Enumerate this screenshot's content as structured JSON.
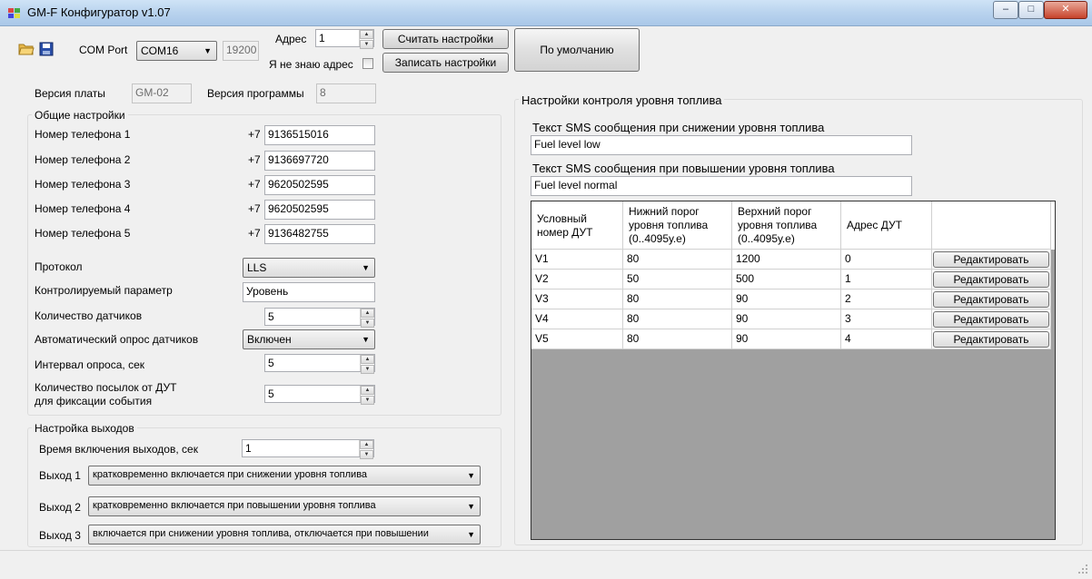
{
  "window": {
    "title": "GM-F Конфигуратор v1.07"
  },
  "toolbar": {
    "com_port_label": "COM Port",
    "com_port_value": "COM16",
    "baud_value": "19200",
    "address_label": "Адрес",
    "address_value": "1",
    "unknown_address_label": "Я не знаю адрес",
    "read_button": "Считать настройки",
    "write_button": "Записать настройки",
    "default_button": "По умолчанию"
  },
  "versions": {
    "board_label": "Версия платы",
    "board_value": "GM-02",
    "program_label": "Версия программы",
    "program_value": "8"
  },
  "general": {
    "title": "Общие настройки",
    "prefix": "+7",
    "phones": [
      {
        "label": "Номер телефона 1",
        "value": "9136515016"
      },
      {
        "label": "Номер телефона 2",
        "value": "9136697720"
      },
      {
        "label": "Номер телефона 3",
        "value": "9620502595"
      },
      {
        "label": "Номер телефона 4",
        "value": "9620502595"
      },
      {
        "label": "Номер телефона 5",
        "value": "9136482755"
      }
    ],
    "protocol_label": "Протокол",
    "protocol_value": "LLS",
    "param_label": "Контролируемый параметр",
    "param_value": "Уровень",
    "sensors_count_label": "Количество датчиков",
    "sensors_count_value": "5",
    "auto_poll_label": "Автоматический опрос датчиков",
    "auto_poll_value": "Включен",
    "interval_label": "Интервал опроса, сек",
    "interval_value": "5",
    "packets_label_1": "Количество посылок  от ДУТ",
    "packets_label_2": "для фиксации события",
    "packets_value": "5"
  },
  "outputs": {
    "title": "Настройка выходов",
    "time_label": "Время включения выходов, сек",
    "time_value": "1",
    "items": [
      {
        "label": "Выход 1",
        "value": "кратковременно включается при снижении уровня топлива"
      },
      {
        "label": "Выход 2",
        "value": "кратковременно включается при повышении уровня топлива"
      },
      {
        "label": "Выход 3",
        "value": "включается при снижении уровня топлива, отключается при повышении"
      }
    ]
  },
  "fuel": {
    "title": "Настройки контроля уровня топлива",
    "sms_low_label": "Текст SMS сообщения при снижении уровня топлива",
    "sms_low_value": "Fuel level low",
    "sms_high_label": "Текст SMS сообщения при повышении уровня топлива",
    "sms_high_value": "Fuel level normal",
    "table": {
      "headers": [
        "Условный номер ДУТ",
        "Нижний порог уровня топлива (0..4095у.е)",
        "Верхний порог уровня топлива (0..4095у.е)",
        "Адрес ДУТ",
        ""
      ],
      "edit_label": "Редактировать",
      "rows": [
        {
          "id": "V1",
          "low": "80",
          "high": "1200",
          "addr": "0"
        },
        {
          "id": "V2",
          "low": "50",
          "high": "500",
          "addr": "1"
        },
        {
          "id": "V3",
          "low": "80",
          "high": "90",
          "addr": "2"
        },
        {
          "id": "V4",
          "low": "80",
          "high": "90",
          "addr": "3"
        },
        {
          "id": "V5",
          "low": "80",
          "high": "90",
          "addr": "4"
        }
      ]
    }
  }
}
